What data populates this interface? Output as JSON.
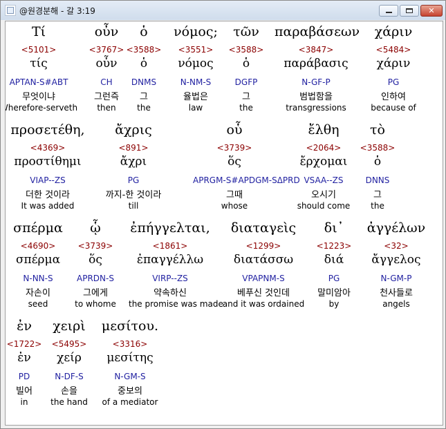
{
  "window": {
    "title": "@원경분해 - 갈 3:19",
    "minimize_label": "",
    "maximize_label": "",
    "close_label": "✕"
  },
  "rows": [
    [
      {
        "greek": "Τί",
        "strong": "<5101>",
        "lemma": "τίς",
        "parse": "APTAN-S#ABT",
        "korean": "무엇이냐",
        "english": "Wherefore-serveth"
      },
      {
        "greek": "οὖν",
        "strong": "<3767>",
        "lemma": "οὖν",
        "parse": "CH",
        "korean": "그런즉",
        "english": "then"
      },
      {
        "greek": "ὁ",
        "strong": "<3588>",
        "lemma": "ὁ",
        "parse": "DNMS",
        "korean": "그",
        "english": "the"
      },
      {
        "greek": "νόμος;",
        "strong": "<3551>",
        "lemma": "νόμος",
        "parse": "N-NM-S",
        "korean": "율법은",
        "english": "law"
      },
      {
        "greek": "τῶν",
        "strong": "<3588>",
        "lemma": "ὁ",
        "parse": "DGFP",
        "korean": "그",
        "english": "the"
      },
      {
        "greek": "παραβάσεων",
        "strong": "<3847>",
        "lemma": "παράβασις",
        "parse": "N-GF-P",
        "korean": "범법함을",
        "english": "transgressions"
      },
      {
        "greek": "χάριν",
        "strong": "<5484>",
        "lemma": "χάριν",
        "parse": "PG",
        "korean": "인하여",
        "english": "because of"
      }
    ],
    [
      {
        "greek": "προσετέθη,",
        "strong": "<4369>",
        "lemma": "προστίθημι",
        "parse": "VIAP--ZS",
        "korean": "더한 것이라",
        "english": "It was added"
      },
      {
        "greek": "ἄχρις",
        "strong": "<891>",
        "lemma": "ἄχρι",
        "parse": "PG",
        "korean": "까지-한 것이라",
        "english": "till"
      },
      {
        "greek": "οὗ",
        "strong": "<3739>",
        "lemma": "ὅς",
        "parse": "APRGM-S#APDGM-SΔPRD",
        "korean": "그때",
        "english": "whose"
      },
      {
        "greek": "ἔλθη",
        "strong": "<2064>",
        "lemma": "ἔρχομαι",
        "parse": "VSAA--ZS",
        "korean": "오시기",
        "english": "should come"
      },
      {
        "greek": "τὸ",
        "strong": "<3588>",
        "lemma": "ὁ",
        "parse": "DNNS",
        "korean": "그",
        "english": "the"
      }
    ],
    [
      {
        "greek": "σπέρμα",
        "strong": "<4690>",
        "lemma": "σπέρμα",
        "parse": "N-NN-S",
        "korean": "자손이",
        "english": "seed"
      },
      {
        "greek": "ᾧ",
        "strong": "<3739>",
        "lemma": "ὅς",
        "parse": "APRDN-S",
        "korean": "그에게",
        "english": "to whome"
      },
      {
        "greek": "ἐπήγγελται,",
        "strong": "<1861>",
        "lemma": "ἐπαγγέλλω",
        "parse": "VIRP--ZS",
        "korean": "약속하신",
        "english": "the promise was made"
      },
      {
        "greek": "διαταγεὶς",
        "strong": "<1299>",
        "lemma": "διατάσσω",
        "parse": "VPAPNM-S",
        "korean": "베푸신 것인데",
        "english": "and it was ordained"
      },
      {
        "greek": "δι᾽",
        "strong": "<1223>",
        "lemma": "διά",
        "parse": "PG",
        "korean": "말미암아",
        "english": "by"
      },
      {
        "greek": "ἀγγέλων",
        "strong": "<32>",
        "lemma": "ἄγγελος",
        "parse": "N-GM-P",
        "korean": "천사들로",
        "english": "angels"
      }
    ],
    [
      {
        "greek": "ἐν",
        "strong": "<1722>",
        "lemma": "ἐν",
        "parse": "PD",
        "korean": "빌어",
        "english": "in"
      },
      {
        "greek": "χειρὶ",
        "strong": "<5495>",
        "lemma": "χείρ",
        "parse": "N-DF-S",
        "korean": "손을",
        "english": "the hand"
      },
      {
        "greek": "μεσίτου.",
        "strong": "<3316>",
        "lemma": "μεσίτης",
        "parse": "N-GM-S",
        "korean": "중보의",
        "english": "of a mediator"
      }
    ]
  ]
}
